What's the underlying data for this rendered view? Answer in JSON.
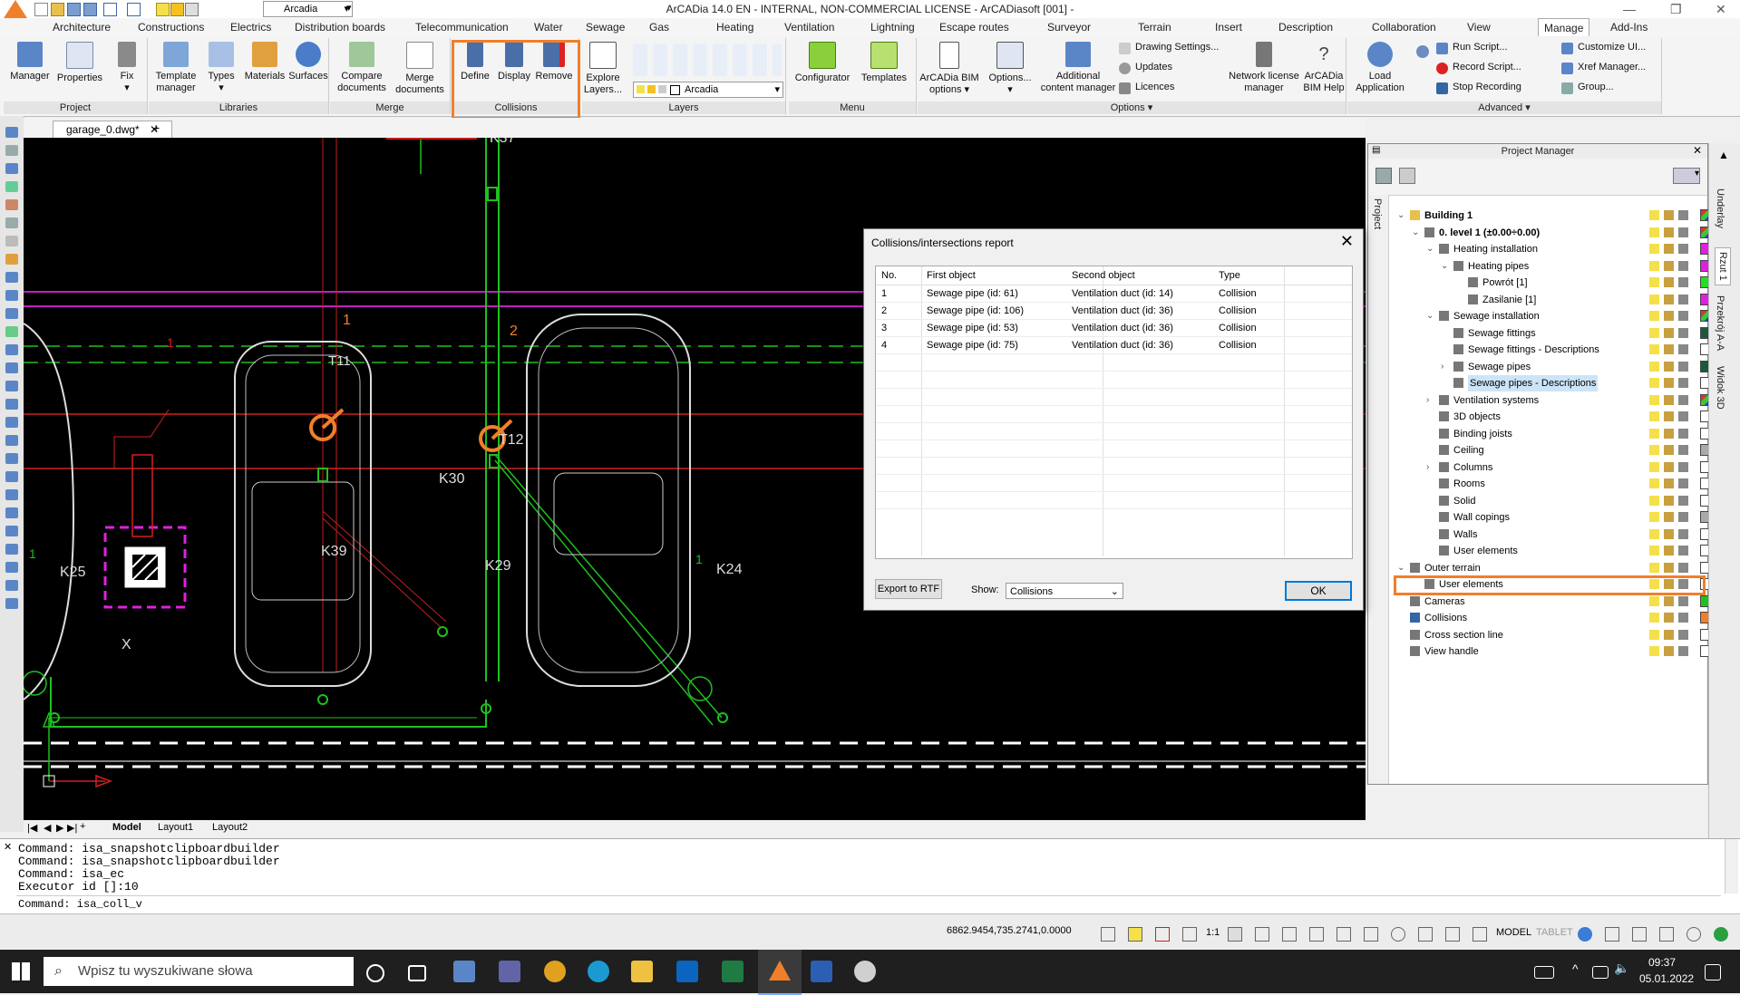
{
  "window": {
    "title": "ArCADia 14.0 EN - INTERNAL, NON-COMMERCIAL LICENSE - ArCADiasoft [001] -",
    "quick_layer": "Arcadia",
    "min_icon": "minimize-icon",
    "max_icon": "restore-icon",
    "close_icon": "close-icon"
  },
  "menu_tabs": [
    "Architecture",
    "Constructions",
    "Electrics",
    "Distribution boards",
    "Telecommunication",
    "Water",
    "Sewage",
    "Gas",
    "Heating",
    "Ventilation",
    "Lightning",
    "Escape routes",
    "Surveyor",
    "Terrain",
    "Insert",
    "Description",
    "Collaboration",
    "View",
    "Manage",
    "Add-Ins"
  ],
  "active_tab": "Manage",
  "ribbon": {
    "project": {
      "label": "Project",
      "buttons": [
        "Manager",
        "Properties",
        "Fix"
      ]
    },
    "libraries": {
      "label": "Libraries",
      "buttons": [
        "Template manager",
        "Types",
        "Materials",
        "Surfaces"
      ]
    },
    "merge": {
      "label": "Merge",
      "buttons": [
        "Compare documents",
        "Merge documents"
      ]
    },
    "collisions": {
      "label": "Collisions",
      "buttons": [
        "Define",
        "Display",
        "Remove"
      ]
    },
    "layers": {
      "label": "Layers",
      "explore": "Explore Layers...",
      "layer_combo": "Arcadia"
    },
    "menu": {
      "label": "Menu",
      "buttons": [
        "Configurator",
        "Templates"
      ]
    },
    "options": {
      "label": "Options ▾",
      "buttons": [
        "ArCADia BIM options",
        "Options...",
        "Additional content manager",
        "Network license manager",
        "ArCADia BIM Help"
      ],
      "small": [
        "Drawing Settings...",
        "Updates",
        "Licences"
      ]
    },
    "advanced": {
      "label": "Advanced ▾",
      "load": "Load Application",
      "small": [
        "Run Script...",
        "Record Script...",
        "Stop Recording",
        "Customize UI...",
        "Xref Manager...",
        "Group..."
      ]
    }
  },
  "document_tab": "garage_0.dwg*",
  "drawing_labels": [
    "K37",
    "T11",
    "K30",
    "T12",
    "K39",
    "K29",
    "K24",
    "K25",
    "X",
    "1",
    "2",
    "1",
    "1",
    "1"
  ],
  "layout_tabs": [
    "Model",
    "Layout1",
    "Layout2"
  ],
  "command_lines": [
    "Command: isa_snapshotclipboardbuilder",
    "Command: isa_snapshotclipboardbuilder",
    "Command: isa_ec",
    "Executor id []:10",
    "Command: isa_coll_v"
  ],
  "status": {
    "coords": "6862.9454,735.2741,0.0000",
    "scale": "1:1",
    "model": "MODEL",
    "tablet": "TABLET"
  },
  "taskbar": {
    "search_placeholder": "Wpisz tu wyszukiwane słowa",
    "time": "09:37",
    "date": "05.01.2022"
  },
  "project_manager": {
    "title": "Project Manager",
    "side_tab": "Project",
    "tree": [
      {
        "label": "Building 1",
        "level": 0,
        "bold": true,
        "exp": "⌄",
        "color": ""
      },
      {
        "label": "0. level 1 (±0.00÷0.00)",
        "level": 1,
        "bold": true,
        "exp": "⌄",
        "color": ""
      },
      {
        "label": "Heating installation",
        "level": 2,
        "bold": false,
        "exp": "⌄",
        "color": "#e020e0"
      },
      {
        "label": "Heating pipes",
        "level": 3,
        "bold": false,
        "exp": "⌄",
        "color": "#e020e0"
      },
      {
        "label": "Powrót [1]",
        "level": 4,
        "bold": false,
        "exp": "",
        "color": "#20e020"
      },
      {
        "label": "Zasilanie [1]",
        "level": 4,
        "bold": false,
        "exp": "",
        "color": "#e020e0"
      },
      {
        "label": "Sewage installation",
        "level": 2,
        "bold": false,
        "exp": "⌄",
        "color": ""
      },
      {
        "label": "Sewage fittings",
        "level": 3,
        "bold": false,
        "exp": "",
        "color": "#1a5a3a"
      },
      {
        "label": "Sewage fittings - Descriptions",
        "level": 3,
        "bold": false,
        "exp": "",
        "color": "#ffffff"
      },
      {
        "label": "Sewage pipes",
        "level": 3,
        "bold": false,
        "exp": "›",
        "color": "#1a5a3a"
      },
      {
        "label": "Sewage pipes - Descriptions",
        "level": 3,
        "bold": false,
        "exp": "",
        "color": "#ffffff",
        "selected": true
      },
      {
        "label": "Ventilation systems",
        "level": 2,
        "bold": false,
        "exp": "›",
        "color": ""
      },
      {
        "label": "3D objects",
        "level": 2,
        "bold": false,
        "exp": "",
        "color": "#ffffff"
      },
      {
        "label": "Binding joists",
        "level": 2,
        "bold": false,
        "exp": "",
        "color": "#ffffff"
      },
      {
        "label": "Ceiling",
        "level": 2,
        "bold": false,
        "exp": "",
        "color": "#aaaaaa"
      },
      {
        "label": "Columns",
        "level": 2,
        "bold": false,
        "exp": "›",
        "color": "#ffffff"
      },
      {
        "label": "Rooms",
        "level": 2,
        "bold": false,
        "exp": "",
        "color": "#ffffff"
      },
      {
        "label": "Solid",
        "level": 2,
        "bold": false,
        "exp": "",
        "color": "#ffffff"
      },
      {
        "label": "Wall copings",
        "level": 2,
        "bold": false,
        "exp": "",
        "color": "#aaaaaa"
      },
      {
        "label": "Walls",
        "level": 2,
        "bold": false,
        "exp": "",
        "color": "#ffffff"
      },
      {
        "label": "User elements",
        "level": 2,
        "bold": false,
        "exp": "",
        "color": "#ffffff"
      },
      {
        "label": "Outer terrain",
        "level": 0,
        "bold": false,
        "exp": "⌄",
        "color": "#ffffff"
      },
      {
        "label": "User elements",
        "level": 1,
        "bold": false,
        "exp": "",
        "color": "#ffffff"
      },
      {
        "label": "Cameras",
        "level": 0,
        "bold": false,
        "exp": "",
        "color": "#20c020"
      },
      {
        "label": "Collisions",
        "level": 0,
        "bold": false,
        "exp": "",
        "color": "#f07f2a",
        "highlight": true
      },
      {
        "label": "Cross section line",
        "level": 0,
        "bold": false,
        "exp": "",
        "color": "#ffffff"
      },
      {
        "label": "View handle",
        "level": 0,
        "bold": false,
        "exp": "",
        "color": "#ffffff"
      }
    ],
    "right_tabs": [
      "Underlay",
      "Rzut 1",
      "Przekrój A-A",
      "Widok 3D"
    ]
  },
  "dialog": {
    "title": "Collisions/intersections report",
    "columns": [
      "No.",
      "First object",
      "Second object",
      "Type"
    ],
    "rows": [
      [
        "1",
        "Sewage pipe (id: 61)",
        "Ventilation duct (id: 14)",
        "Collision"
      ],
      [
        "2",
        "Sewage pipe (id: 106)",
        "Ventilation duct (id: 36)",
        "Collision"
      ],
      [
        "3",
        "Sewage pipe (id: 53)",
        "Ventilation duct (id: 36)",
        "Collision"
      ],
      [
        "4",
        "Sewage pipe (id: 75)",
        "Ventilation duct (id: 36)",
        "Collision"
      ]
    ],
    "export_label": "Export to RTF",
    "show_label": "Show:",
    "show_value": "Collisions",
    "ok_label": "OK"
  },
  "colors": {
    "highlight": "#f07f2a",
    "canvas": "#000000",
    "green_pipe": "#1fc01f",
    "magenta": "#e020e0"
  }
}
